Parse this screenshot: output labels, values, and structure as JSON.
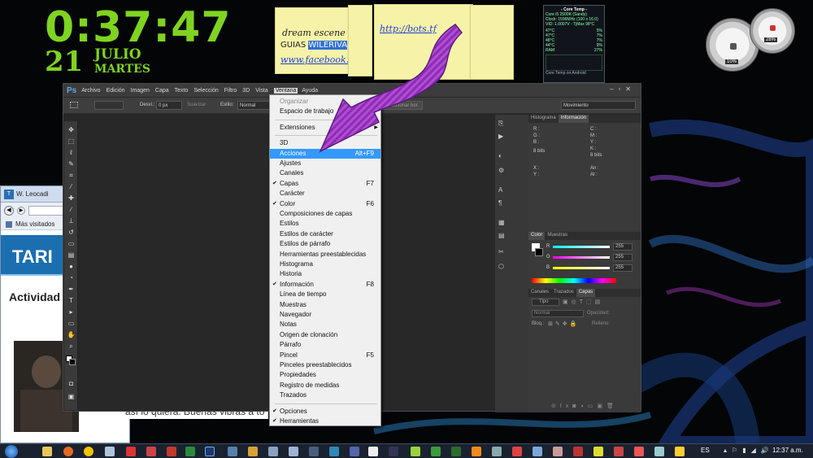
{
  "clock": {
    "time": "0:37:47",
    "day": "21",
    "month": "JULIO",
    "weekday": "MARTES"
  },
  "notes": {
    "note1_line1": "dream escene",
    "note1_line2": "GUIAS",
    "note1_highlight": "WILERIVA",
    "note1_link": "www.facebook.com/",
    "note2_link": "http://bots.tf"
  },
  "core_temp": {
    "title": "- Core Temp -",
    "cpu": "Core i5 2500K (Sandy)",
    "clock": "Clock: 1596MHz (100 x 16.0)",
    "vid": "VID: 1.0007V - TjMax 98°C",
    "cores": [
      "47°C",
      "47°C",
      "48°C",
      "44°C"
    ],
    "loads": [
      "5%",
      "7%",
      "7%",
      "9%"
    ],
    "ram_label": "RAM",
    "ram_value": "27%",
    "footer": "Core Temp on Android"
  },
  "gauges": {
    "left": "10%",
    "right": "28%"
  },
  "photoshop": {
    "logo": "Ps",
    "menu": [
      "Archivo",
      "Edición",
      "Imagen",
      "Capa",
      "Texto",
      "Selección",
      "Filtro",
      "3D",
      "Vista",
      "Ventana",
      "Ayuda"
    ],
    "active_menu": "Ventana",
    "options": {
      "desv_label": "Desvi.:",
      "desv_value": "0 px",
      "suavizar": "Suavizar",
      "estilo_label": "Estilo:",
      "estilo_value": "Normal",
      "selection_button": "seleccionar bor.",
      "workspace": "Movimiento"
    },
    "panels": {
      "tab_histograma": "Histograma",
      "tab_informacion": "Información",
      "info_rgb": [
        "R :",
        "G :",
        "B :"
      ],
      "info_cmyk": [
        "C :",
        "M :",
        "Y :",
        "K :"
      ],
      "bits_left": "8 bits",
      "bits_right": "8 bits",
      "info_xy": [
        "X :",
        "Y :"
      ],
      "info_anal": [
        "An :",
        "Al :"
      ],
      "tab_color": "Color",
      "tab_muestras": "Muestras",
      "color_rows": [
        {
          "label": "R",
          "value": "255"
        },
        {
          "label": "G",
          "value": "255"
        },
        {
          "label": "B",
          "value": "255"
        }
      ],
      "tab_canales": "Canales",
      "tab_trazados": "Trazados",
      "tab_capas": "Capas",
      "tipo": "Tipo",
      "blend": "Normal",
      "opacidad": "Opacidad:",
      "bloq": "Bloq.:",
      "relleno": "Relleno:"
    }
  },
  "ventana_menu": [
    {
      "label": "Organizar",
      "disabled": true,
      "arrow": true
    },
    {
      "label": "Espacio de trabajo",
      "arrow": true
    },
    {
      "sep": true
    },
    {
      "label": "Extensiones",
      "arrow": true
    },
    {
      "sep": true
    },
    {
      "label": "3D"
    },
    {
      "label": "Acciones",
      "shortcut": "Alt+F9",
      "highlight": true
    },
    {
      "label": "Ajustes"
    },
    {
      "label": "Canales"
    },
    {
      "label": "Capas",
      "shortcut": "F7",
      "checked": true
    },
    {
      "label": "Carácter"
    },
    {
      "label": "Color",
      "shortcut": "F6",
      "checked": true
    },
    {
      "label": "Composiciones de capas"
    },
    {
      "label": "Estilos"
    },
    {
      "label": "Estilos de carácter"
    },
    {
      "label": "Estilos de párrafo"
    },
    {
      "label": "Herramientas preestablecidas"
    },
    {
      "label": "Histograma"
    },
    {
      "label": "Historia"
    },
    {
      "label": "Información",
      "shortcut": "F8",
      "checked": true
    },
    {
      "label": "Línea de tiempo"
    },
    {
      "label": "Muestras"
    },
    {
      "label": "Navegador"
    },
    {
      "label": "Notas"
    },
    {
      "label": "Origen de clonación"
    },
    {
      "label": "Párrafo"
    },
    {
      "label": "Pincel",
      "shortcut": "F5"
    },
    {
      "label": "Pinceles preestablecidos"
    },
    {
      "label": "Propiedades"
    },
    {
      "label": "Registro de medidas"
    },
    {
      "label": "Trazados"
    },
    {
      "sep": true
    },
    {
      "label": "Opciones",
      "checked": true
    },
    {
      "label": "Herramientas",
      "checked": true
    }
  ],
  "browser": {
    "tab_title": "W. Leocadi",
    "bookmarks": "Más visitados",
    "banner": "TARI",
    "heading": "Actividad",
    "caption": "así lo quiera. Buenas vibras a to"
  },
  "taskbar": {
    "lang": "ES",
    "time": "12:37 a.m."
  },
  "colors": {
    "clock_green": "#7fd321",
    "menu_highlight": "#3399ff",
    "arrow_purple": "#b44bd8",
    "note_yellow": "#f6f3a8"
  }
}
